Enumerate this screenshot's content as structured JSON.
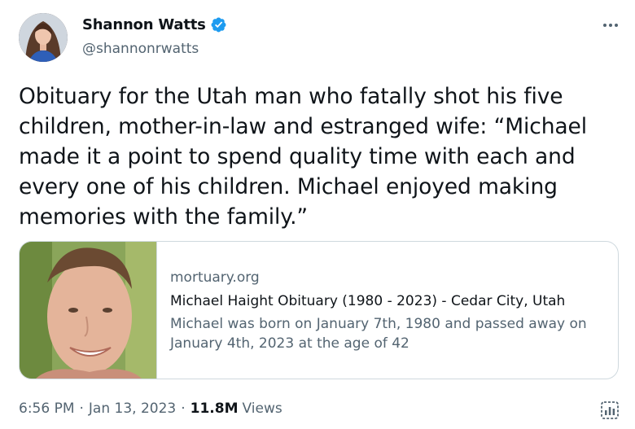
{
  "author": {
    "name": "Shannon Watts",
    "handle": "@shannonrwatts",
    "verified": true,
    "avatar_icon": "user-avatar"
  },
  "tweet": {
    "text": "Obituary for the Utah man who fatally shot his five children, mother-in-law and estranged wife: “Michael made it a point to spend quality time with each and every one of his children. Michael enjoyed making memories with the family.”"
  },
  "card": {
    "domain": "mortuary.org",
    "title": "Michael Haight Obituary (1980 - 2023) - Cedar City, Utah",
    "description": "Michael was born on January 7th, 1980 and passed away on January 4th, 2023 at the age of 42"
  },
  "meta": {
    "time": "6:56 PM",
    "date": "Jan 13, 2023",
    "separator": "·",
    "views_count": "11.8M",
    "views_label": "Views"
  },
  "icons": {
    "more": "more-horizontal-icon",
    "verified": "verified-badge-icon",
    "analytics": "analytics-icon"
  },
  "colors": {
    "verified_blue": "#1d9bf0",
    "secondary_text": "#536471",
    "primary_text": "#0f1419",
    "border": "#cfd9de"
  }
}
